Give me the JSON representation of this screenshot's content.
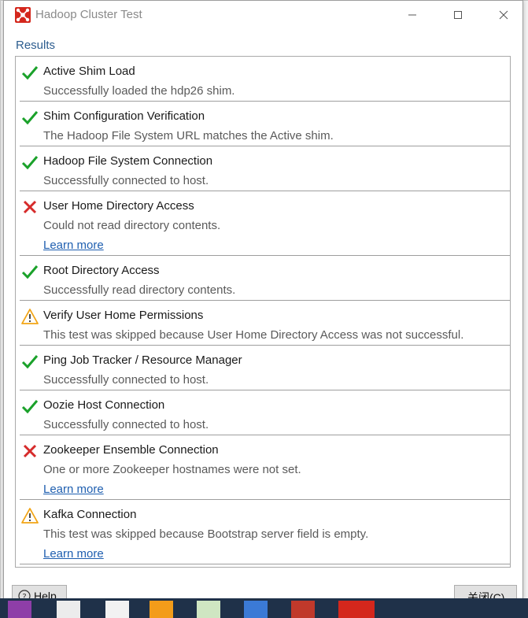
{
  "window": {
    "title": "Hadoop Cluster Test"
  },
  "results_label": "Results",
  "results": [
    {
      "status": "success",
      "name": "Active Shim Load",
      "message": "Successfully loaded the hdp26 shim.",
      "link": ""
    },
    {
      "status": "success",
      "name": "Shim Configuration Verification",
      "message": "The Hadoop File System URL matches the Active shim.",
      "link": ""
    },
    {
      "status": "success",
      "name": "Hadoop File System Connection",
      "message": "Successfully connected to host.",
      "link": ""
    },
    {
      "status": "error",
      "name": "User Home Directory Access",
      "message": "Could not read directory contents.",
      "link": "Learn more"
    },
    {
      "status": "success",
      "name": "Root Directory Access",
      "message": "Successfully read directory contents.",
      "link": ""
    },
    {
      "status": "warning",
      "name": "Verify User Home Permissions",
      "message": "This test was skipped because User Home Directory Access was not successful.",
      "link": ""
    },
    {
      "status": "success",
      "name": "Ping Job Tracker / Resource Manager",
      "message": "Successfully connected to host.",
      "link": ""
    },
    {
      "status": "success",
      "name": "Oozie Host Connection",
      "message": "Successfully connected to host.",
      "link": ""
    },
    {
      "status": "error",
      "name": "Zookeeper Ensemble Connection",
      "message": "One or more Zookeeper hostnames were not set.",
      "link": "Learn more"
    },
    {
      "status": "warning",
      "name": "Kafka Connection",
      "message": "This test was skipped because Bootstrap server field is empty.",
      "link": "Learn more"
    }
  ],
  "buttons": {
    "help": "Help",
    "close": "关闭(C)"
  },
  "colors": {
    "success": "#1aa12a",
    "error": "#d62b2b",
    "warning": "#f2a516",
    "link": "#1f5fb0",
    "brand": "#d4271c"
  }
}
